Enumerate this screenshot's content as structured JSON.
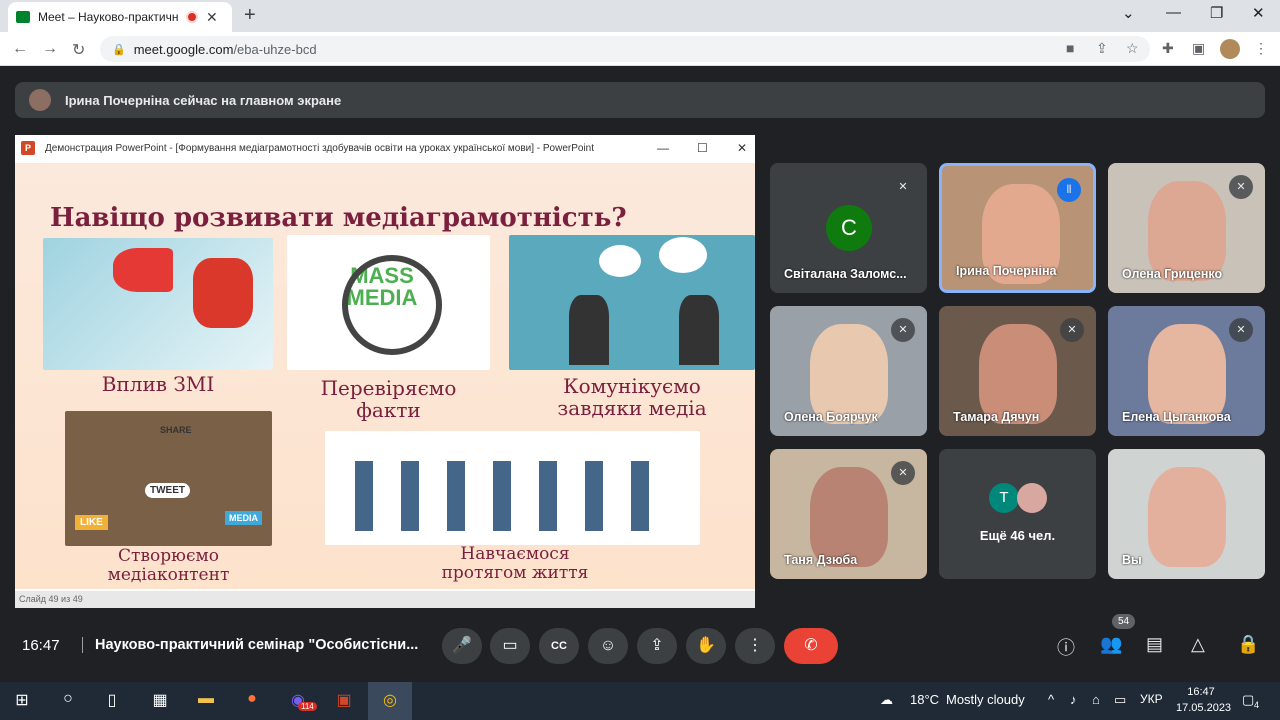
{
  "browser": {
    "tab_title": "Meet – Науково-практичний",
    "url_host": "meet.google.com",
    "url_path": "/eba-uhze-bcd"
  },
  "banner": {
    "text": "Ірина Почерніна сейчас на главном экране"
  },
  "ppt": {
    "window_title": "Демонстрация PowerPoint - [Формування медіаграмотності здобувачів освіти на уроках української мови] - PowerPoint",
    "status": "Слайд 49 из 49",
    "slide": {
      "title": "Навіщо розвивати медіаграмотність?",
      "captions": [
        "Вплив ЗМІ",
        "Перевіряємо\nфакти",
        "Комунікуємо\nзавдяки медіа",
        "Створюємо\nмедіаконтент",
        "Навчаємося\nпротягом життя"
      ],
      "mass_media": "MASS MEDIA",
      "tweet": "TWEET",
      "like": "LIKE",
      "media": "MEDIA",
      "share": "SHARE"
    }
  },
  "participants": [
    {
      "name": "Світалана Заломс...",
      "avatar_letter": "C",
      "avatar_color": "#0f7b0f"
    },
    {
      "name": "Ірина Почерніна",
      "speaking": true
    },
    {
      "name": "Олена Гриценко"
    },
    {
      "name": "Олена Боярчук"
    },
    {
      "name": "Тамара Дячун"
    },
    {
      "name": "Елена Цыганкова"
    },
    {
      "name": "Таня Дзюба"
    },
    {
      "name": "Ещё 46 чел.",
      "avatar_letter": "T"
    },
    {
      "name": "Вы"
    }
  ],
  "controls": {
    "time": "16:47",
    "meeting_title": "Науково-практичний семінар \"Особистісни...",
    "people_count": "54"
  },
  "taskbar": {
    "weather_temp": "18°C",
    "weather_text": "Mostly cloudy",
    "lang": "УКР",
    "clock_time": "16:47",
    "clock_date": "17.05.2023",
    "chat_badge": "114",
    "notif": "4"
  }
}
